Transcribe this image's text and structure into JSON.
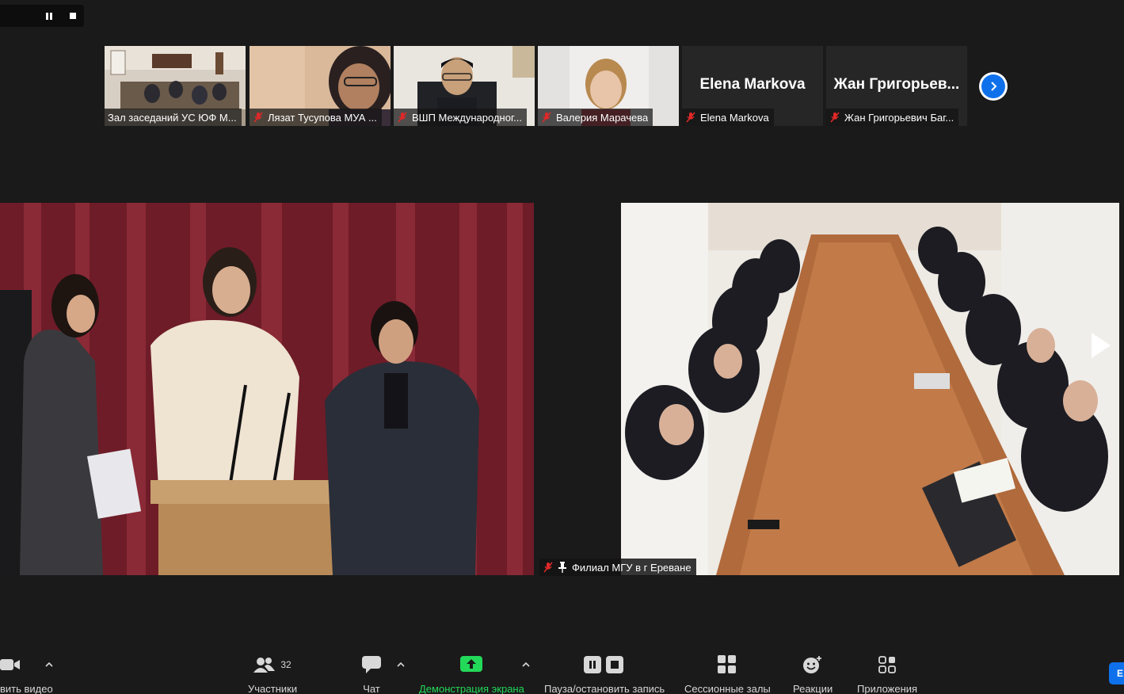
{
  "recording": {
    "pause_icon": "pause-icon",
    "stop_icon": "stop-icon"
  },
  "thumbnails": [
    {
      "label": "Зал заседаний УС ЮФ М...",
      "muted": false,
      "big_name": ""
    },
    {
      "label": "Лязат Тусупова МУА ...",
      "muted": true,
      "big_name": ""
    },
    {
      "label": "ВШП Международног...",
      "muted": true,
      "big_name": ""
    },
    {
      "label": "Валерия Марачева",
      "muted": true,
      "big_name": ""
    },
    {
      "label": "Elena Markova",
      "muted": true,
      "big_name": "Elena Markova"
    },
    {
      "label": "Жан Григорьевич Баг...",
      "muted": true,
      "big_name": "Жан Григорьев..."
    }
  ],
  "next_page_icon": "chevron-right-icon",
  "pinned_video": {
    "label": "Филиал МГУ в г Ереване",
    "muted": true,
    "pinned": true
  },
  "toolbar": {
    "video_label": "вить видео",
    "participants_label": "Участники",
    "participants_count": "32",
    "chat_label": "Чат",
    "share_label": "Демонстрация экрана",
    "record_label": "Пауза/остановить запись",
    "breakout_label": "Сессионные залы",
    "reactions_label": "Реакции",
    "apps_label": "Приложения",
    "end_label": "E"
  },
  "colors": {
    "accent": "#0e71eb",
    "share_green": "#23d959",
    "mic_red": "#e02828",
    "background": "#1a1a1a"
  }
}
